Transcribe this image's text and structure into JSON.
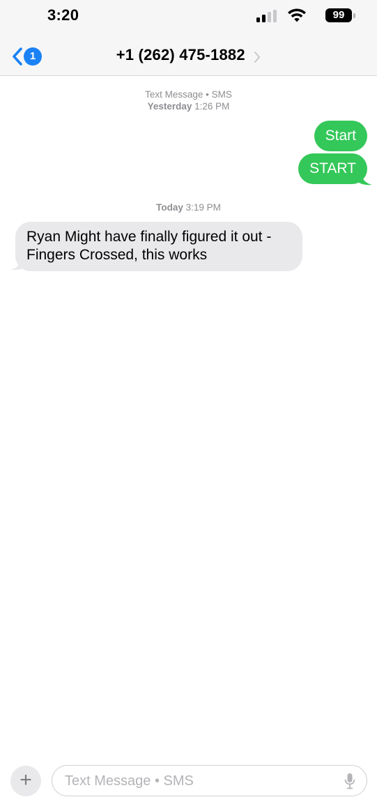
{
  "status_bar": {
    "time": "3:20",
    "battery_level": "99",
    "signal_bars_active": 2,
    "signal_bars_total": 4
  },
  "header": {
    "back_badge_count": "1",
    "contact_name": "+1 (262) 475-1882"
  },
  "thread": {
    "meta_1": {
      "line1": "Text Message • SMS",
      "line2_day": "Yesterday",
      "line2_time": "1:26 PM"
    },
    "sent_messages": [
      "Start",
      "START"
    ],
    "meta_2": {
      "day": "Today",
      "time": "3:19 PM"
    },
    "received_messages": [
      {
        "line1": "Ryan Might have finally figured it out -",
        "line2": "Fingers Crossed, this works"
      }
    ]
  },
  "compose": {
    "placeholder": "Text Message • SMS",
    "plus_symbol": "+"
  },
  "colors": {
    "sent_bubble": "#34c759",
    "received_bubble": "#e9e9eb",
    "accent_blue": "#1b82f6",
    "meta_text": "#8e8e93"
  },
  "icons": [
    "back-chevron-icon",
    "signal-icon",
    "wifi-icon",
    "battery-icon",
    "contact-chevron-icon",
    "plus-icon",
    "microphone-icon"
  ]
}
